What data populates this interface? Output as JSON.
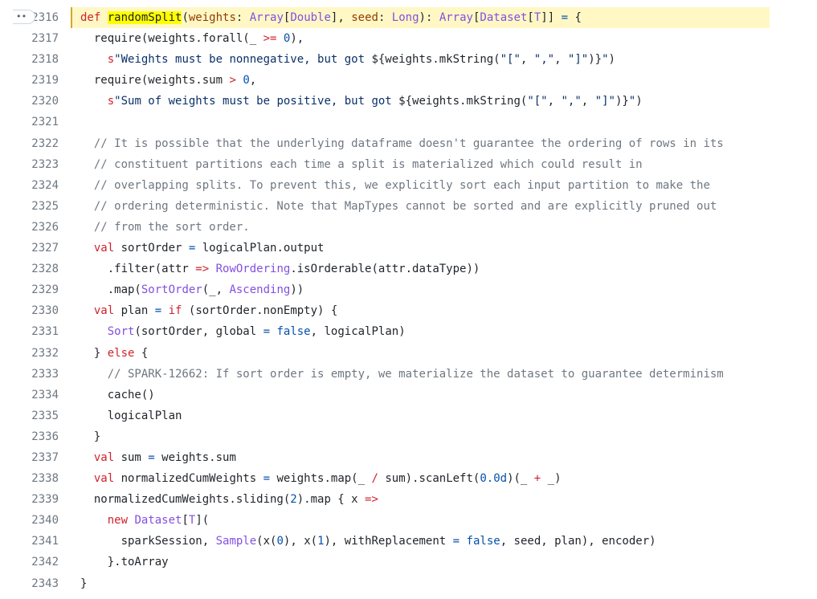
{
  "more_button": "••",
  "highlight_line": 2316,
  "lines": [
    {
      "n": "2316",
      "i": 2,
      "t": [
        [
          "k",
          "def "
        ],
        [
          "m",
          "randomSplit"
        ],
        [
          "",
          "("
        ],
        [
          "p",
          "weights"
        ],
        [
          "",
          ": "
        ],
        [
          "t",
          "Array"
        ],
        [
          "",
          "["
        ],
        [
          "t",
          "Double"
        ],
        [
          "",
          "], "
        ],
        [
          "p",
          "seed"
        ],
        [
          "",
          ": "
        ],
        [
          "t",
          "Long"
        ],
        [
          "",
          "): "
        ],
        [
          "t",
          "Array"
        ],
        [
          "",
          "["
        ],
        [
          "t",
          "Dataset"
        ],
        [
          "",
          "["
        ],
        [
          "t",
          "T"
        ],
        [
          "",
          "]] "
        ],
        [
          "b",
          "="
        ],
        [
          "",
          " {"
        ]
      ]
    },
    {
      "n": "2317",
      "i": 4,
      "t": [
        [
          "",
          "require(weights.forall(_ "
        ],
        [
          "o",
          ">="
        ],
        [
          "",
          " "
        ],
        [
          "n",
          "0"
        ],
        [
          "",
          "),"
        ]
      ]
    },
    {
      "n": "2318",
      "i": 6,
      "t": [
        [
          "k",
          "s"
        ],
        [
          "s",
          "\"Weights must be nonnegative, but got "
        ],
        [
          "",
          "${weights.mkString("
        ],
        [
          "s",
          "\"[\""
        ],
        [
          "",
          ", "
        ],
        [
          "s",
          "\",\""
        ],
        [
          "",
          ", "
        ],
        [
          "s",
          "\"]\""
        ],
        [
          "",
          ")}"
        ],
        [
          "s",
          "\""
        ],
        [
          "",
          ")"
        ]
      ]
    },
    {
      "n": "2319",
      "i": 4,
      "t": [
        [
          "",
          "require(weights.sum "
        ],
        [
          "o",
          ">"
        ],
        [
          "",
          " "
        ],
        [
          "n",
          "0"
        ],
        [
          "",
          ","
        ]
      ]
    },
    {
      "n": "2320",
      "i": 6,
      "t": [
        [
          "k",
          "s"
        ],
        [
          "s",
          "\"Sum of weights must be positive, but got "
        ],
        [
          "",
          "${weights.mkString("
        ],
        [
          "s",
          "\"[\""
        ],
        [
          "",
          ", "
        ],
        [
          "s",
          "\",\""
        ],
        [
          "",
          ", "
        ],
        [
          "s",
          "\"]\""
        ],
        [
          "",
          ")}"
        ],
        [
          "s",
          "\""
        ],
        [
          "",
          ")"
        ]
      ]
    },
    {
      "n": "2321",
      "i": 0,
      "t": []
    },
    {
      "n": "2322",
      "i": 4,
      "t": [
        [
          "c",
          "// It is possible that the underlying dataframe doesn't guarantee the ordering of rows in its"
        ]
      ]
    },
    {
      "n": "2323",
      "i": 4,
      "t": [
        [
          "c",
          "// constituent partitions each time a split is materialized which could result in"
        ]
      ]
    },
    {
      "n": "2324",
      "i": 4,
      "t": [
        [
          "c",
          "// overlapping splits. To prevent this, we explicitly sort each input partition to make the"
        ]
      ]
    },
    {
      "n": "2325",
      "i": 4,
      "t": [
        [
          "c",
          "// ordering deterministic. Note that MapTypes cannot be sorted and are explicitly pruned out"
        ]
      ]
    },
    {
      "n": "2326",
      "i": 4,
      "t": [
        [
          "c",
          "// from the sort order."
        ]
      ]
    },
    {
      "n": "2327",
      "i": 4,
      "t": [
        [
          "k",
          "val "
        ],
        [
          "",
          "sortOrder "
        ],
        [
          "b",
          "="
        ],
        [
          "",
          " logicalPlan.output"
        ]
      ]
    },
    {
      "n": "2328",
      "i": 6,
      "t": [
        [
          "",
          ".filter(attr "
        ],
        [
          "o",
          "=>"
        ],
        [
          "",
          " "
        ],
        [
          "t",
          "RowOrdering"
        ],
        [
          "",
          ".isOrderable(attr.dataType))"
        ]
      ]
    },
    {
      "n": "2329",
      "i": 6,
      "t": [
        [
          "",
          ".map("
        ],
        [
          "t",
          "SortOrder"
        ],
        [
          "",
          "(_, "
        ],
        [
          "t",
          "Ascending"
        ],
        [
          "",
          "))"
        ]
      ]
    },
    {
      "n": "2330",
      "i": 4,
      "t": [
        [
          "k",
          "val "
        ],
        [
          "",
          "plan "
        ],
        [
          "b",
          "="
        ],
        [
          "",
          " "
        ],
        [
          "k",
          "if"
        ],
        [
          "",
          " (sortOrder.nonEmpty) {"
        ]
      ]
    },
    {
      "n": "2331",
      "i": 6,
      "t": [
        [
          "t",
          "Sort"
        ],
        [
          "",
          "(sortOrder, global "
        ],
        [
          "b",
          "="
        ],
        [
          "",
          " "
        ],
        [
          "b",
          "false"
        ],
        [
          "",
          ", logicalPlan)"
        ]
      ]
    },
    {
      "n": "2332",
      "i": 4,
      "t": [
        [
          "",
          "} "
        ],
        [
          "k",
          "else"
        ],
        [
          "",
          " {"
        ]
      ]
    },
    {
      "n": "2333",
      "i": 6,
      "t": [
        [
          "c",
          "// SPARK-12662: If sort order is empty, we materialize the dataset to guarantee determinism"
        ]
      ]
    },
    {
      "n": "2334",
      "i": 6,
      "t": [
        [
          "",
          "cache()"
        ]
      ]
    },
    {
      "n": "2335",
      "i": 6,
      "t": [
        [
          "",
          "logicalPlan"
        ]
      ]
    },
    {
      "n": "2336",
      "i": 4,
      "t": [
        [
          "",
          "}"
        ]
      ]
    },
    {
      "n": "2337",
      "i": 4,
      "t": [
        [
          "k",
          "val "
        ],
        [
          "",
          "sum "
        ],
        [
          "b",
          "="
        ],
        [
          "",
          " weights.sum"
        ]
      ]
    },
    {
      "n": "2338",
      "i": 4,
      "t": [
        [
          "k",
          "val "
        ],
        [
          "",
          "normalizedCumWeights "
        ],
        [
          "b",
          "="
        ],
        [
          "",
          " weights.map(_ "
        ],
        [
          "o",
          "/"
        ],
        [
          "",
          " sum).scanLeft("
        ],
        [
          "n",
          "0.0d"
        ],
        [
          "",
          ")(_ "
        ],
        [
          "o",
          "+"
        ],
        [
          "",
          " _)"
        ]
      ]
    },
    {
      "n": "2339",
      "i": 4,
      "t": [
        [
          "",
          "normalizedCumWeights.sliding("
        ],
        [
          "n",
          "2"
        ],
        [
          "",
          ").map { x "
        ],
        [
          "o",
          "=>"
        ]
      ]
    },
    {
      "n": "2340",
      "i": 6,
      "t": [
        [
          "k",
          "new "
        ],
        [
          "t",
          "Dataset"
        ],
        [
          "",
          "["
        ],
        [
          "t",
          "T"
        ],
        [
          "",
          "]("
        ]
      ]
    },
    {
      "n": "2341",
      "i": 8,
      "t": [
        [
          "",
          "sparkSession, "
        ],
        [
          "t",
          "Sample"
        ],
        [
          "",
          "(x("
        ],
        [
          "n",
          "0"
        ],
        [
          "",
          "), x("
        ],
        [
          "n",
          "1"
        ],
        [
          "",
          "), withReplacement "
        ],
        [
          "b",
          "="
        ],
        [
          "",
          " "
        ],
        [
          "b",
          "false"
        ],
        [
          "",
          ", seed, plan), encoder)"
        ]
      ]
    },
    {
      "n": "2342",
      "i": 6,
      "t": [
        [
          "",
          "}.toArray"
        ]
      ]
    },
    {
      "n": "2343",
      "i": 2,
      "t": [
        [
          "",
          "}"
        ]
      ]
    }
  ]
}
